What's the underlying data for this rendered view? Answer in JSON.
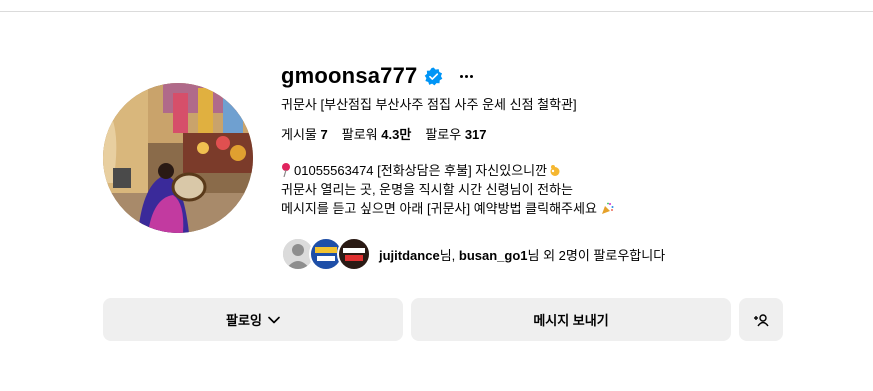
{
  "profile": {
    "username": "gmoonsa777",
    "verified": true,
    "full_name": "귀문사 [부산점집 부산사주 점집 사주 운세 신점 철학관]",
    "stats": {
      "posts_label": "게시물",
      "posts_value": "7",
      "followers_label": "팔로워",
      "followers_value": "4.3만",
      "following_label": "팔로우",
      "following_value": "317"
    },
    "bio": {
      "line1": "01055563474 [전화상담은 후불] 자신있으니깐",
      "line2": "귀문사 열리는 곳, 운명을 직시할 시간 신령님이 전하는",
      "line3": "메시지를 듣고 싶으면 아래 [귀문사] 예약방법 클릭해주세요"
    },
    "followed_by": {
      "user1": "jujitdance",
      "suffix1": "님, ",
      "user2": "busan_go1",
      "suffix2": "님 외 2명이 팔로우합니다"
    }
  },
  "actions": {
    "following_label": "팔로잉",
    "message_label": "메시지 보내기",
    "add_user_icon": "add-person-icon"
  },
  "colors": {
    "verified": "#0095f6",
    "button_bg": "#efefef",
    "divider": "#dbdbdb"
  }
}
